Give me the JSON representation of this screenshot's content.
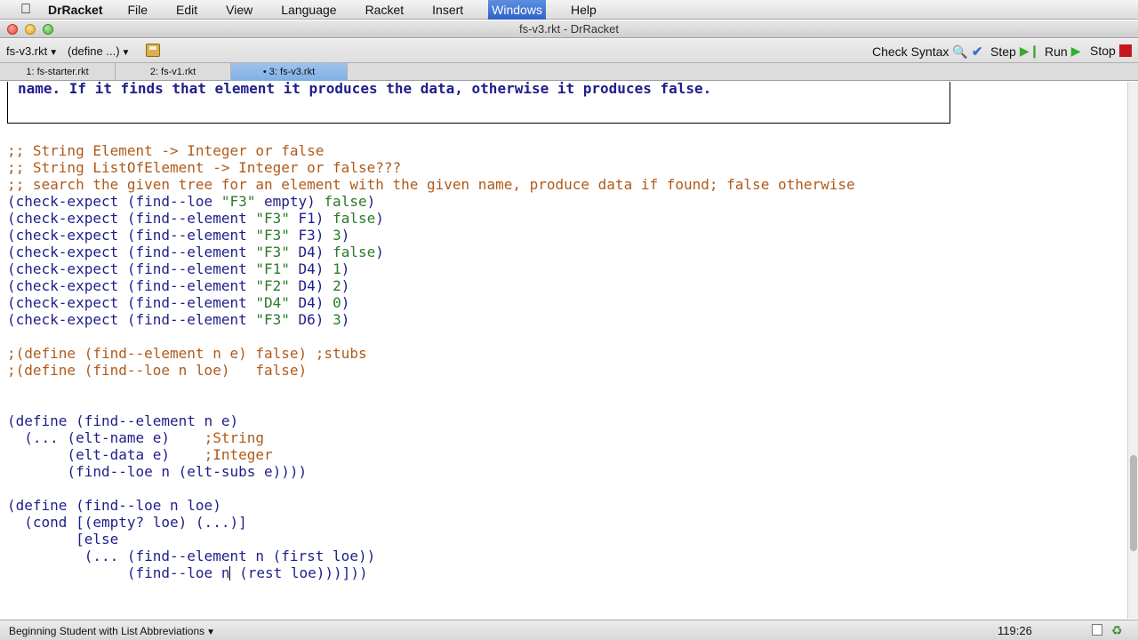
{
  "menubar": {
    "app": "DrRacket",
    "items": [
      "File",
      "Edit",
      "View",
      "Language",
      "Racket",
      "Insert",
      "Windows",
      "Help"
    ],
    "active": "Windows"
  },
  "window": {
    "title": "fs-v3.rkt - DrRacket"
  },
  "toolbar": {
    "file_menu": "fs-v3.rkt",
    "define_menu": "(define ...)",
    "check_syntax": "Check Syntax",
    "step": "Step",
    "run": "Run",
    "stop": "Stop"
  },
  "tabs": [
    {
      "label": "1: fs-starter.rkt",
      "active": false
    },
    {
      "label": "2: fs-v1.rkt",
      "active": false
    },
    {
      "label": "• 3: fs-v3.rkt",
      "active": true
    }
  ],
  "editor": {
    "comment_box_text": "name. If it finds that element it produces the data, otherwise it produces false.",
    "lines": [
      ";; String Element -> Integer or false",
      ";; String ListOfElement -> Integer or false???",
      ";; search the given tree for an element with the given name, produce data if found; false otherwise",
      "(check-expect (find--loe \"F3\" empty) false)",
      "(check-expect (find--element \"F3\" F1) false)",
      "(check-expect (find--element \"F3\" F3) 3)",
      "(check-expect (find--element \"F3\" D4) false)",
      "(check-expect (find--element \"F1\" D4) 1)",
      "(check-expect (find--element \"F2\" D4) 2)",
      "(check-expect (find--element \"D4\" D4) 0)",
      "(check-expect (find--element \"F3\" D6) 3)",
      "",
      ";(define (find--element n e) false) ;stubs",
      ";(define (find--loe n loe)   false)",
      "",
      "",
      "(define (find--element n e)",
      "  (... (elt-name e)    ;String",
      "       (elt-data e)    ;Integer",
      "       (find--loe n (elt-subs e))))",
      "",
      "(define (find--loe n loe)",
      "  (cond [(empty? loe) (...)]",
      "        [else",
      "         (... (find--element n (first loe))",
      "              (find--loe n (rest loe)))]))"
    ]
  },
  "status": {
    "language": "Beginning Student with List Abbreviations",
    "position": "119:26"
  }
}
